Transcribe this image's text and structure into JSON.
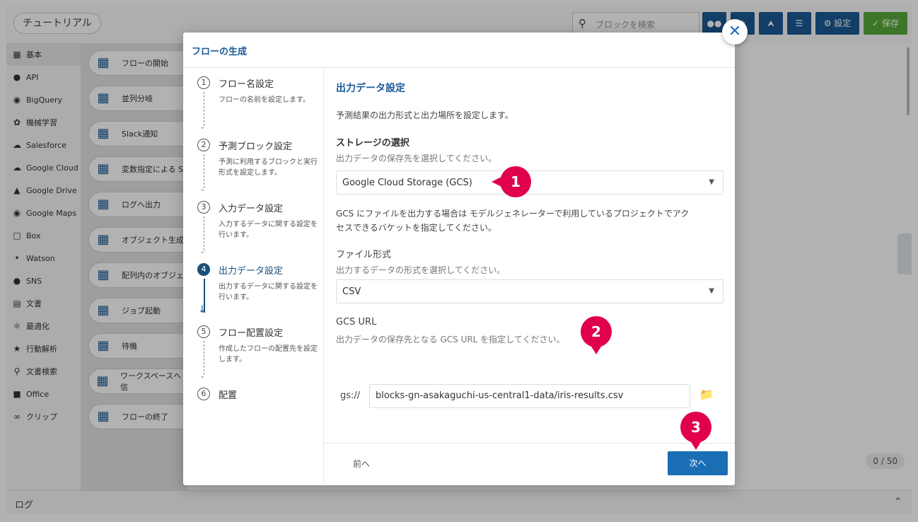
{
  "topbar": {
    "tutorial_label": "チュートリアル",
    "search_placeholder": "ブロックを検索",
    "settings_label": "設定",
    "save_label": "保存"
  },
  "sidebar": {
    "items": [
      {
        "label": "基本",
        "icon": "cube-icon"
      },
      {
        "label": "API",
        "icon": "api-icon"
      },
      {
        "label": "BigQuery",
        "icon": "bigquery-icon"
      },
      {
        "label": "機械学習",
        "icon": "brain-icon"
      },
      {
        "label": "Salesforce",
        "icon": "cloud-icon"
      },
      {
        "label": "Google Cloud",
        "icon": "google-cloud-icon"
      },
      {
        "label": "Google Drive",
        "icon": "google-drive-icon"
      },
      {
        "label": "Google Maps",
        "icon": "map-pin-icon"
      },
      {
        "label": "Box",
        "icon": "box-icon"
      },
      {
        "label": "Watson",
        "icon": "watson-icon"
      },
      {
        "label": "SNS",
        "icon": "chat-icon"
      },
      {
        "label": "文書",
        "icon": "document-icon"
      },
      {
        "label": "最適化",
        "icon": "atom-icon"
      },
      {
        "label": "行動解析",
        "icon": "person-icon"
      },
      {
        "label": "文書検索",
        "icon": "doc-search-icon"
      },
      {
        "label": "Office",
        "icon": "office-icon"
      },
      {
        "label": "クリップ",
        "icon": "clip-icon"
      }
    ]
  },
  "palette": {
    "blocks": [
      "フローの開始",
      "並列分岐",
      "Slack通知",
      "変数指定による S",
      "ログへ出力",
      "オブジェクト生成",
      "配列内のオブジェ 変換",
      "ジョブ起動",
      "待機",
      "ワークスペースへ ジを送信",
      "フローの終了"
    ]
  },
  "canvas": {
    "counter": "0 / 50"
  },
  "log_bar": {
    "label": "ログ"
  },
  "modal": {
    "title": "フローの生成",
    "steps": [
      {
        "num": "1",
        "title": "フロー名設定",
        "desc": "フローの名前を設定します。"
      },
      {
        "num": "2",
        "title": "予測ブロック設定",
        "desc": "予測に利用するブロックと実行形式を設定します。"
      },
      {
        "num": "3",
        "title": "入力データ設定",
        "desc": "入力するデータに関する設定を行います。"
      },
      {
        "num": "4",
        "title": "出力データ設定",
        "desc": "出力するデータに関する設定を行います。"
      },
      {
        "num": "5",
        "title": "フロー配置設定",
        "desc": "作成したフローの配置先を設定します。"
      },
      {
        "num": "6",
        "title": "配置",
        "desc": ""
      }
    ],
    "content": {
      "heading": "出力データ設定",
      "intro": "予測結果の出力形式と出力場所を設定します。",
      "storage_label": "ストレージの選択",
      "storage_help": "出力データの保存先を選択してください。",
      "storage_value": "Google Cloud Storage (GCS)",
      "gcs_note_line1": "GCS にファイルを出力する場合は モデルジェネレーターで利用しているプロジェクトでアク",
      "gcs_note_line2": "セスできるバケットを指定してください。",
      "format_label": "ファイル形式",
      "format_help": "出力するデータの形式を選択してください。",
      "format_value": "CSV",
      "url_label": "GCS URL",
      "url_help": "出力データの保存先となる GCS URL を指定してください。",
      "url_prefix": "gs://",
      "url_value": "blocks-gn-asakaguchi-us-central1-data/iris-results.csv"
    },
    "footer": {
      "prev_label": "前へ",
      "next_label": "次へ"
    }
  },
  "callouts": [
    "1",
    "2",
    "3"
  ],
  "colors": {
    "accent": "#1a5a96",
    "callout": "#e0004d",
    "save": "#5aaa3c"
  }
}
